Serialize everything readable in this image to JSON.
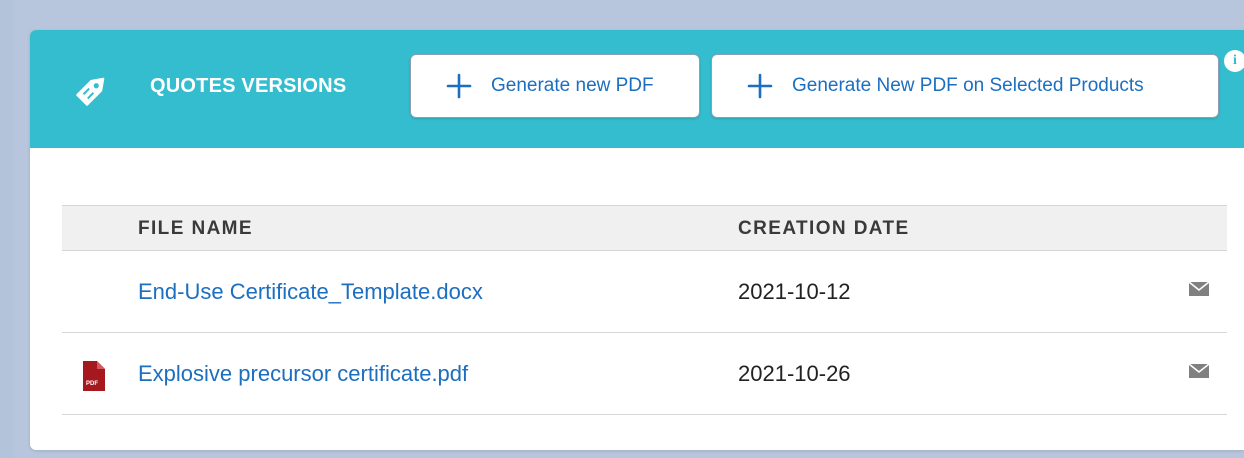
{
  "header": {
    "title": "QUOTES VERSIONS",
    "icon": "tag-icon",
    "accent_color": "#34bdcf",
    "buttons": [
      {
        "label": "Generate new PDF",
        "icon": "plus-icon"
      },
      {
        "label": "Generate New PDF on Selected Products",
        "icon": "plus-icon"
      }
    ],
    "info_badge": "i"
  },
  "table": {
    "columns": [
      "FILE NAME",
      "CREATION DATE"
    ],
    "rows": [
      {
        "file_name": "End-Use Certificate_Template.docx",
        "creation_date": "2021-10-12",
        "file_icon": "none",
        "action_icon": "mail-icon"
      },
      {
        "file_name": "Explosive precursor certificate.pdf",
        "creation_date": "2021-10-26",
        "file_icon": "pdf-icon",
        "action_icon": "mail-icon"
      }
    ]
  },
  "colors": {
    "link": "#1c6fc0",
    "page_background": "#b7c6dc",
    "pdf_icon": "#a5181e"
  }
}
